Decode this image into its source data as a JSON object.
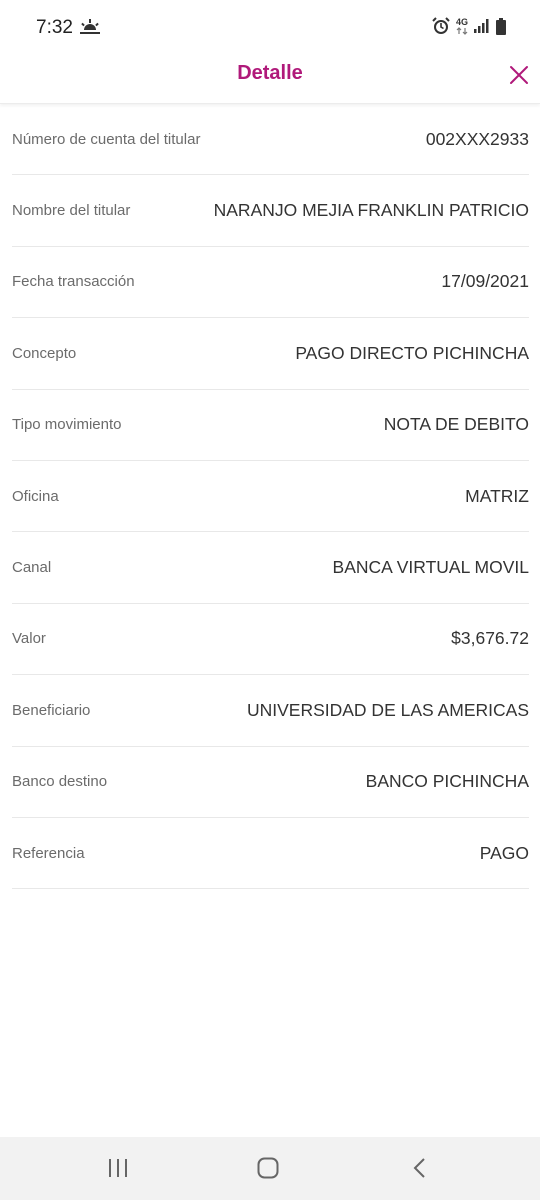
{
  "status": {
    "time": "7:32",
    "network": "4G"
  },
  "header": {
    "title": "Detalle"
  },
  "details": [
    {
      "label": "Número de cuenta del titular",
      "value": "002XXX2933"
    },
    {
      "label": "Nombre del titular",
      "value": "NARANJO MEJIA FRANKLIN PATRICIO"
    },
    {
      "label": "Fecha transacción",
      "value": "17/09/2021"
    },
    {
      "label": "Concepto",
      "value": "PAGO DIRECTO PICHINCHA"
    },
    {
      "label": "Tipo movimiento",
      "value": "NOTA DE DEBITO"
    },
    {
      "label": "Oficina",
      "value": "MATRIZ"
    },
    {
      "label": "Canal",
      "value": "BANCA VIRTUAL MOVIL"
    },
    {
      "label": "Valor",
      "value": "$3,676.72"
    },
    {
      "label": "Beneficiario",
      "value": "UNIVERSIDAD DE LAS AMERICAS"
    },
    {
      "label": "Banco destino",
      "value": "BANCO PICHINCHA"
    },
    {
      "label": "Referencia",
      "value": "PAGO"
    }
  ],
  "colors": {
    "accent": "#b0197a"
  }
}
